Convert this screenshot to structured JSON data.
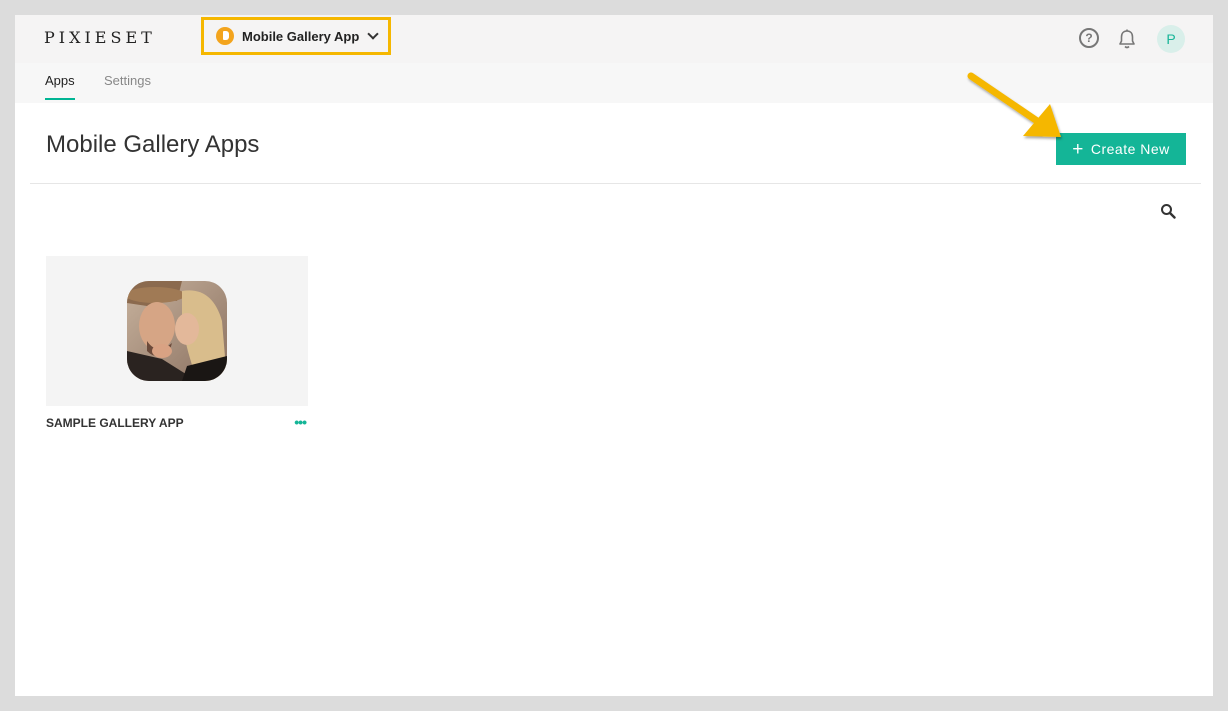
{
  "header": {
    "logo_text": "PIXIESET",
    "product_switcher": {
      "label": "Mobile Gallery App",
      "icon": "mobile-gallery-app-icon"
    },
    "help_icon_label": "?",
    "avatar_initial": "P"
  },
  "nav": {
    "tabs": [
      {
        "label": "Apps",
        "active": true
      },
      {
        "label": "Settings",
        "active": false
      }
    ]
  },
  "main": {
    "title": "Mobile Gallery Apps",
    "create_button_label": "Create New",
    "create_button_icon": "plus-icon",
    "apps": [
      {
        "name": "SAMPLE GALLERY APP",
        "thumbnail": "couple-kissing-photo",
        "menu_icon": "more-icon"
      }
    ]
  },
  "colors": {
    "accent": "#14b597",
    "highlight": "#f5b700",
    "product_icon": "#f3a41d"
  }
}
